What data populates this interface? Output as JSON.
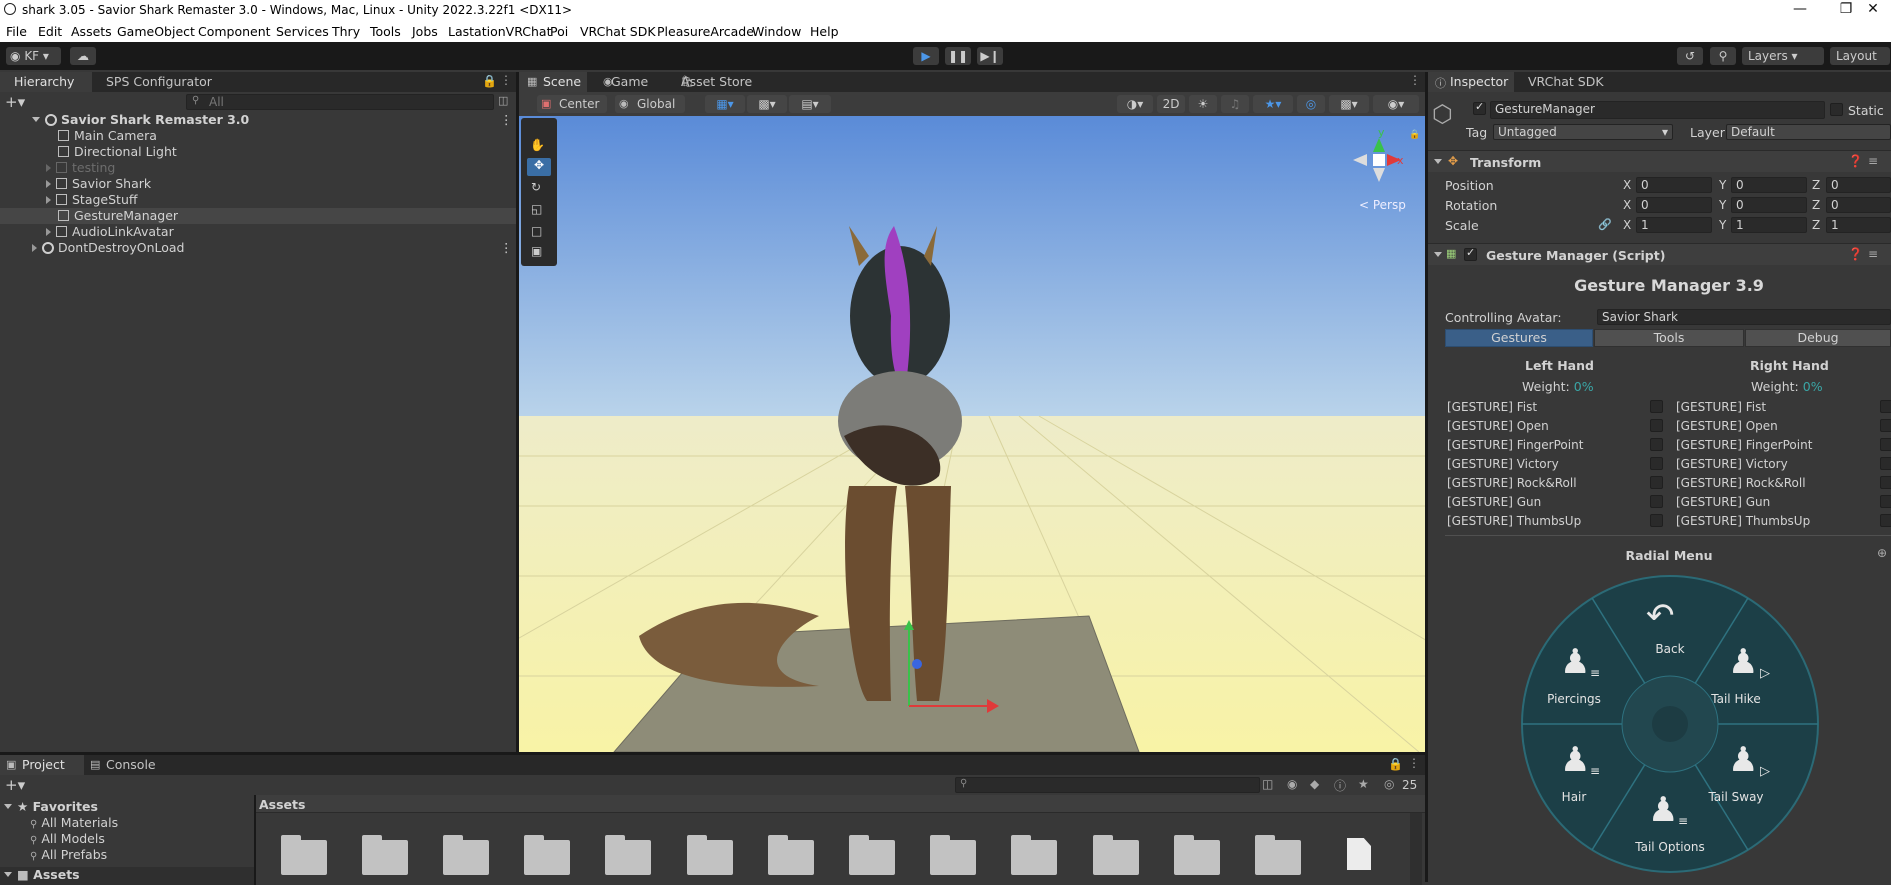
{
  "window": {
    "title": "shark 3.05 - Savior Shark Remaster 3.0 - Windows, Mac, Linux - Unity 2022.3.22f1 <DX11>"
  },
  "menu": [
    "File",
    "Edit",
    "Assets",
    "GameObject",
    "Component",
    "Services",
    "Thry",
    "Tools",
    "Jobs",
    "LastationVRChat",
    "Poi",
    "VRChat SDK",
    "PleasureArcade",
    "Window",
    "Help"
  ],
  "toolbar": {
    "account": "KF",
    "layers": "Layers",
    "layout": "Layout"
  },
  "hierarchy": {
    "tabs": [
      "Hierarchy",
      "SPS Configurator"
    ],
    "search_placeholder": "All",
    "scene": "Savior Shark Remaster 3.0",
    "items": [
      "Main Camera",
      "Directional Light",
      "testing",
      "Savior Shark",
      "StageStuff",
      "GestureManager",
      "AudioLinkAvatar"
    ],
    "dontdestroy": "DontDestroyOnLoad"
  },
  "scene_view": {
    "tabs": [
      "Scene",
      "Game",
      "Asset Store"
    ],
    "pivot": "Center",
    "space": "Global",
    "mode_2d": "2D",
    "persp": "< Persp",
    "gizmo_y": "y",
    "gizmo_x": "x"
  },
  "inspector": {
    "tabs": [
      "Inspector",
      "VRChat SDK"
    ],
    "object_name": "GestureManager",
    "static_label": "Static",
    "tag_label": "Tag",
    "tag_value": "Untagged",
    "layer_label": "Layer",
    "layer_value": "Default",
    "transform": {
      "header": "Transform",
      "position": "Position",
      "rotation": "Rotation",
      "scale": "Scale",
      "axis_x": "X",
      "axis_y": "Y",
      "axis_z": "Z",
      "pos": [
        "0",
        "0",
        "0"
      ],
      "rot": [
        "0",
        "0",
        "0"
      ],
      "scl": [
        "1",
        "1",
        "1"
      ]
    },
    "script_header": "Gesture Manager (Script)",
    "gm_title": "Gesture Manager 3.9",
    "controlling_label": "Controlling Avatar:",
    "controlling_value": "Savior Shark",
    "gm_tabs": [
      "Gestures",
      "Tools",
      "Debug"
    ],
    "left_hand": "Left Hand",
    "right_hand": "Right Hand",
    "weight_label": "Weight:",
    "weight_value": "0%",
    "gestures": [
      "[GESTURE] Fist",
      "[GESTURE] Open",
      "[GESTURE] FingerPoint",
      "[GESTURE] Victory",
      "[GESTURE] Rock&Roll",
      "[GESTURE] Gun",
      "[GESTURE] ThumbsUp"
    ],
    "radial_title": "Radial Menu",
    "radial": {
      "back": "Back",
      "piercings": "Piercings",
      "tail_hike": "Tail Hike",
      "hair": "Hair",
      "tail_sway": "Tail Sway",
      "tail_options": "Tail Options"
    }
  },
  "project": {
    "tabs": [
      "Project",
      "Console"
    ],
    "favorites": "Favorites",
    "fav_items": [
      "All Materials",
      "All Models",
      "All Prefabs"
    ],
    "assets_root": "Assets",
    "assets_header": "Assets",
    "hidden_count": "25"
  },
  "colors": {
    "accent": "#3a79bb",
    "panel": "#383838",
    "dark": "#191919",
    "radial_bg": "#1a4a52"
  }
}
